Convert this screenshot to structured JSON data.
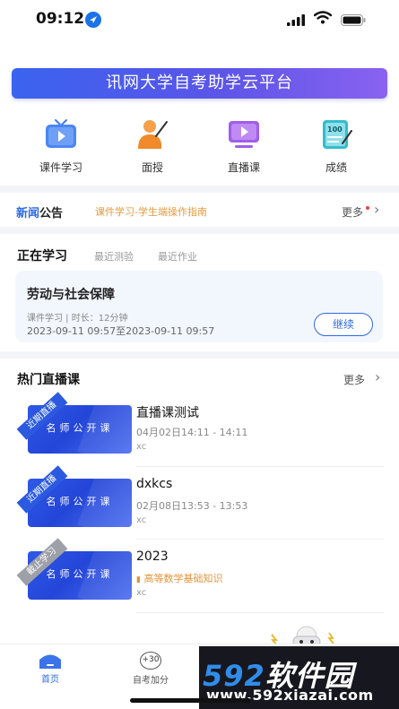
{
  "status_bar": {
    "time": "09:12"
  },
  "banner": {
    "title": "讯网大学自考助学云平台"
  },
  "quick_nav": [
    {
      "label": "课件学习",
      "icon": "tv-play-icon",
      "color": "#3f7bf0"
    },
    {
      "label": "面授",
      "icon": "teacher-icon",
      "color": "#f08a2a"
    },
    {
      "label": "直播课",
      "icon": "live-play-icon",
      "color": "#9a55e8"
    },
    {
      "label": "成绩",
      "icon": "score-icon",
      "color": "#2cb5c8"
    }
  ],
  "news": {
    "label_prefix": "新闻",
    "label_suffix": "公告",
    "item": "课件学习-学生端操作指南",
    "more": "更多"
  },
  "study": {
    "tabs": [
      "正在学习",
      "最近测验",
      "最近作业"
    ],
    "card": {
      "title": "劳动与社会保障",
      "meta": "课件学习 | 时长：12分钟",
      "time": "2023-09-11 09:57至2023-09-11 09:57",
      "button": "继续"
    }
  },
  "live": {
    "title": "热门直播课",
    "more": "更多",
    "thumb_text": "名师公开课",
    "items": [
      {
        "ribbon": "近期直播",
        "name": "直播课测试",
        "date": "04月02日14:11 - 14:11",
        "teacher": "xc"
      },
      {
        "ribbon": "近期直播",
        "name": "dxkcs",
        "date": "02月08日13:53 - 13:53",
        "teacher": "xc"
      },
      {
        "ribbon": "截止学习",
        "name": "2023",
        "subject": "高等数学基础知识",
        "teacher": "xc"
      }
    ]
  },
  "tabbar": {
    "home": "首页",
    "score": "自考加分",
    "score_badge": "+30"
  },
  "watermark": {
    "logo_num": "592",
    "logo_cn": "软件园",
    "url": "www.592xiazai.com"
  },
  "colors": {
    "accent": "#2f6be0",
    "news_orange": "#e29a3c",
    "banner_start": "#3a63ef",
    "banner_end": "#8a62f0"
  }
}
